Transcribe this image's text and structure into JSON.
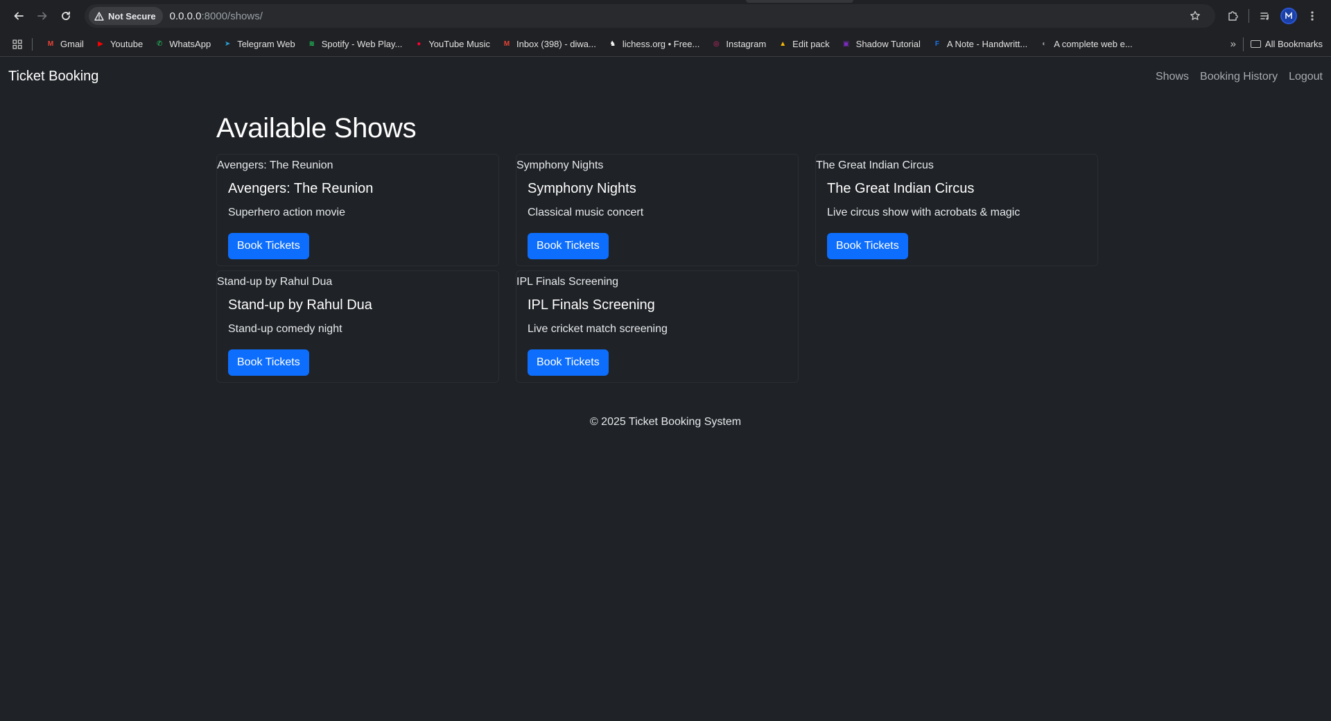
{
  "browser": {
    "security_label": "Not Secure",
    "url_host": "0.0.0.0",
    "url_rest": ":8000/shows/"
  },
  "bookmarks": [
    {
      "label": "Gmail",
      "icon": "gmail-icon",
      "color": "#ea4335",
      "glyph": "M"
    },
    {
      "label": "Youtube",
      "icon": "youtube-icon",
      "color": "#ff0000",
      "glyph": "▶"
    },
    {
      "label": "WhatsApp",
      "icon": "whatsapp-icon",
      "color": "#25d366",
      "glyph": "✆"
    },
    {
      "label": "Telegram Web",
      "icon": "telegram-icon",
      "color": "#2aa1da",
      "glyph": "➤"
    },
    {
      "label": "Spotify - Web Play...",
      "icon": "spotify-icon",
      "color": "#1ed760",
      "glyph": "≋"
    },
    {
      "label": "YouTube Music",
      "icon": "youtube-music-icon",
      "color": "#ff0033",
      "glyph": "●"
    },
    {
      "label": "Inbox (398) - diwa...",
      "icon": "gmail-icon",
      "color": "#ea4335",
      "glyph": "M"
    },
    {
      "label": "lichess.org • Free...",
      "icon": "lichess-icon",
      "color": "#ffffff",
      "glyph": "♞"
    },
    {
      "label": "Instagram",
      "icon": "instagram-icon",
      "color": "#d62976",
      "glyph": "◎"
    },
    {
      "label": "Edit pack",
      "icon": "google-drive-icon",
      "color": "#fbbc04",
      "glyph": "▲"
    },
    {
      "label": "Shadow Tutorial",
      "icon": "shadow-tutorial-icon",
      "color": "#7b2cbf",
      "glyph": "▣"
    },
    {
      "label": "A Note - Handwritt...",
      "icon": "note-icon",
      "color": "#1a73e8",
      "glyph": "F"
    },
    {
      "label": "A complete web e...",
      "icon": "globe-icon",
      "color": "#9aa0a6",
      "glyph": "◐"
    }
  ],
  "bookmarks_all_label": "All Bookmarks",
  "site": {
    "brand": "Ticket Booking",
    "nav": [
      "Shows",
      "Booking History",
      "Logout"
    ]
  },
  "page_title": "Available Shows",
  "shows": [
    {
      "image_alt": "Avengers: The Reunion",
      "title": "Avengers: The Reunion",
      "description": "Superhero action movie",
      "button": "Book Tickets"
    },
    {
      "image_alt": "Symphony Nights",
      "title": "Symphony Nights",
      "description": "Classical music concert",
      "button": "Book Tickets"
    },
    {
      "image_alt": "The Great Indian Circus",
      "title": "The Great Indian Circus",
      "description": "Live circus show with acrobats & magic",
      "button": "Book Tickets"
    },
    {
      "image_alt": "Stand-up by Rahul Dua",
      "title": "Stand-up by Rahul Dua",
      "description": "Stand-up comedy night",
      "button": "Book Tickets"
    },
    {
      "image_alt": "IPL Finals Screening",
      "title": "IPL Finals Screening",
      "description": "Live cricket match screening",
      "button": "Book Tickets"
    }
  ],
  "footer": "© 2025 Ticket Booking System"
}
